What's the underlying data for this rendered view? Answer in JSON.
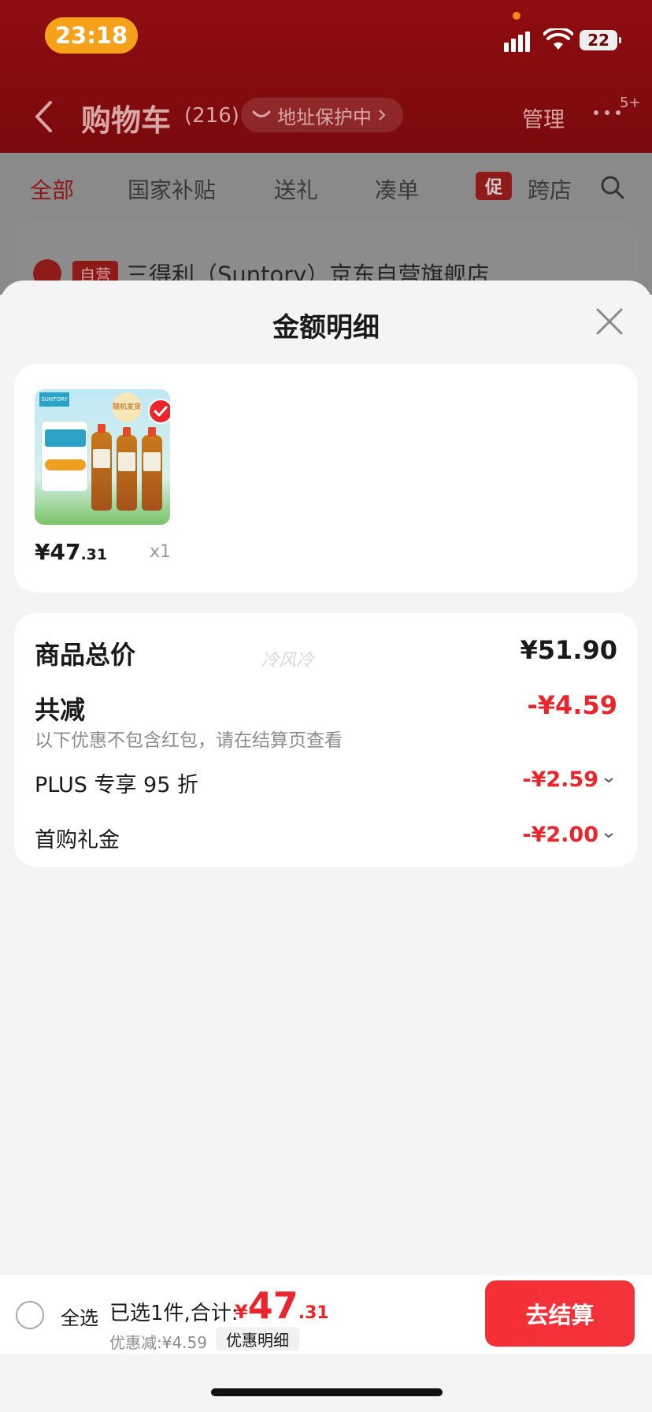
{
  "status_bar": {
    "time": "23:18",
    "battery": "22"
  },
  "header": {
    "title": "购物车",
    "count": "(216)",
    "address_protect": "地址保护中",
    "manage": "管理",
    "more_badge": "5+"
  },
  "tabs": [
    "全部",
    "国家补贴",
    "送礼",
    "凑单",
    "促",
    "跨店"
  ],
  "store": {
    "tag": "自营",
    "name": "三得利（Suntory）京东自营旗舰店"
  },
  "sheet": {
    "title": "金额明细",
    "product": {
      "price_int": "¥47",
      "price_dec": ".31",
      "qty": "x1",
      "brand_text": "SUNTORY",
      "sticker_text": "随机发货"
    },
    "summary": {
      "total_label": "商品总价",
      "total_value": "¥51.90",
      "reduce_label": "共减",
      "reduce_value": "-¥4.59",
      "note": "以下优惠不包含红包，请在结算页查看",
      "items": [
        {
          "label": "PLUS 专享 95 折",
          "value": "-¥2.59"
        },
        {
          "label": "首购礼金",
          "value": "-¥2.00"
        }
      ]
    },
    "watermark": "冷风冷"
  },
  "bottom_bar": {
    "select_all": "全选",
    "selected_text": "已选1件,合计:",
    "total_currency": "¥",
    "total_int": "47",
    "total_dec": ".31",
    "discount_text": "优惠减:¥4.59",
    "detail_label": "优惠明细",
    "checkout_label": "去结算"
  },
  "colors": {
    "header_red": "#8f0d10",
    "accent_red": "#e8262c",
    "time_pill": "#f5a11a",
    "checkout": "#f52f36"
  }
}
